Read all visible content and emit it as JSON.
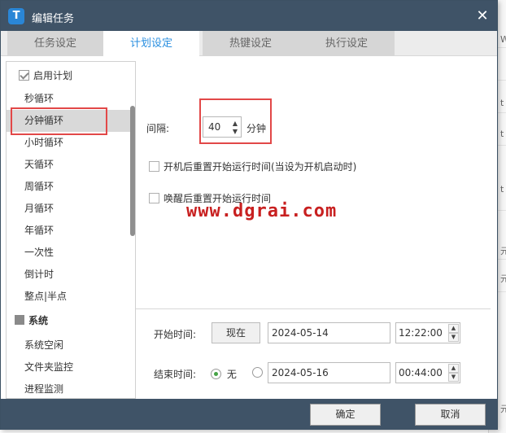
{
  "window": {
    "title": "编辑任务",
    "logo_letter": "T"
  },
  "tabs": [
    {
      "label": "任务设定"
    },
    {
      "label": "计划设定",
      "active": true
    },
    {
      "label": "热键设定"
    },
    {
      "label": "执行设定"
    }
  ],
  "sidebar": {
    "enable_plan_label": "启用计划",
    "items": [
      {
        "label": "秒循环"
      },
      {
        "label": "分钟循环",
        "selected": true
      },
      {
        "label": "小时循环"
      },
      {
        "label": "天循环"
      },
      {
        "label": "周循环"
      },
      {
        "label": "月循环"
      },
      {
        "label": "年循环"
      },
      {
        "label": "一次性"
      },
      {
        "label": "倒计时"
      },
      {
        "label": "整点|半点"
      }
    ],
    "group_label": "系统",
    "group_items": [
      {
        "label": "系统空闲"
      },
      {
        "label": "文件夹监控"
      },
      {
        "label": "进程监测"
      }
    ]
  },
  "interval": {
    "label": "间隔:",
    "value": "40",
    "unit": "分钟"
  },
  "options": {
    "reset_on_boot": "开机后重置开始运行时间(当设为开机启动时)",
    "reset_on_wake": "唤醒后重置开始运行时间"
  },
  "start": {
    "label": "开始时间:",
    "now_button": "现在",
    "date": "2024-05-14",
    "time": "12:22:00"
  },
  "end": {
    "label": "结束时间:",
    "none_label": "无",
    "date": "2024-05-16",
    "time": "00:44:00"
  },
  "footer": {
    "ok_label": "确定",
    "cancel_label": "取消"
  },
  "watermark": "www.dgrai.com",
  "background": {
    "edge_letters": [
      "W",
      "t",
      "t",
      "t",
      "元",
      "元",
      "元"
    ]
  },
  "colors": {
    "titlebar": "#3f5367",
    "accent": "#2a8fe0",
    "highlight": "#e24848",
    "watermark": "#c82020"
  }
}
